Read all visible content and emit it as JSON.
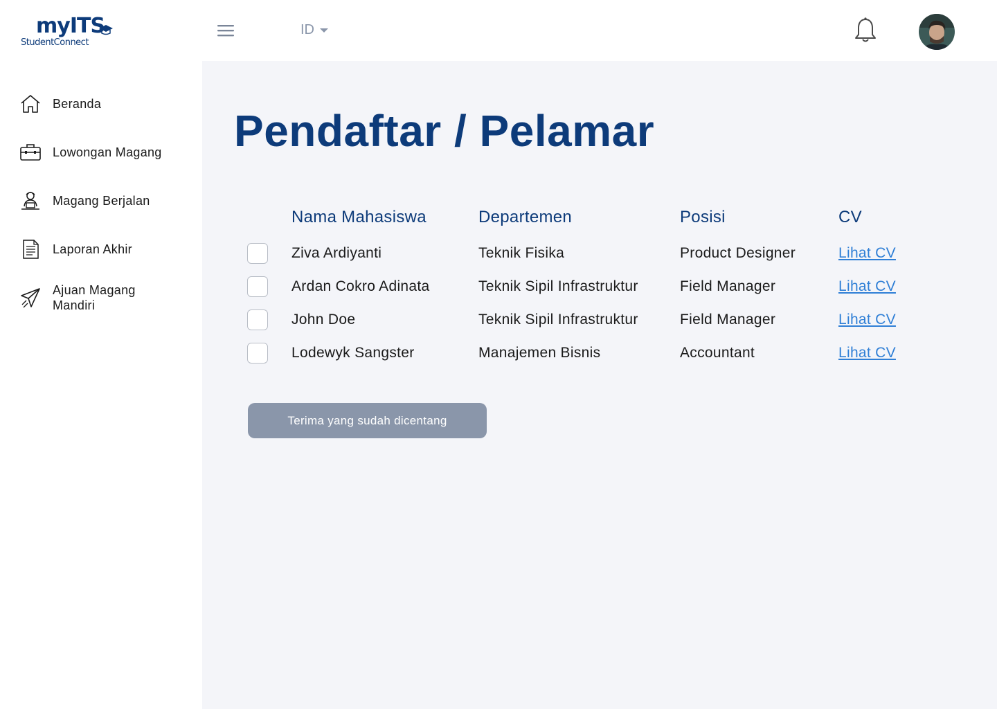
{
  "app": {
    "logo_brand": "myITS",
    "logo_sub": "StudentConnect",
    "language": "ID"
  },
  "sidebar": {
    "items": [
      {
        "label": "Beranda",
        "icon": "home-icon"
      },
      {
        "label": "Lowongan Magang",
        "icon": "briefcase-icon"
      },
      {
        "label": "Magang Berjalan",
        "icon": "worker-laptop-icon"
      },
      {
        "label": "Laporan Akhir",
        "icon": "document-icon"
      },
      {
        "label": "Ajuan Magang Mandiri",
        "icon": "paper-plane-icon"
      }
    ]
  },
  "main": {
    "title": "Pendaftar / Pelamar",
    "columns": [
      "Nama Mahasiswa",
      "Departemen",
      "Posisi",
      "CV"
    ],
    "rows": [
      {
        "name": "Ziva Ardiyanti",
        "department": "Teknik Fisika",
        "position": "Product Designer",
        "cv": "Lihat CV",
        "checked": false
      },
      {
        "name": "Ardan Cokro Adinata",
        "department": "Teknik Sipil Infrastruktur",
        "position": "Field Manager",
        "cv": "Lihat CV",
        "checked": false
      },
      {
        "name": "John Doe",
        "department": "Teknik Sipil Infrastruktur",
        "position": "Field Manager",
        "cv": "Lihat CV",
        "checked": false
      },
      {
        "name": "Lodewyk Sangster",
        "department": "Manajemen Bisnis",
        "position": "Accountant",
        "cv": "Lihat CV",
        "checked": false
      }
    ],
    "accept_button": "Terima yang sudah dicentang"
  },
  "colors": {
    "primary": "#0d3b7a",
    "link": "#2f7fd6",
    "button_disabled": "#8a96aa",
    "background": "#f4f5f9"
  }
}
